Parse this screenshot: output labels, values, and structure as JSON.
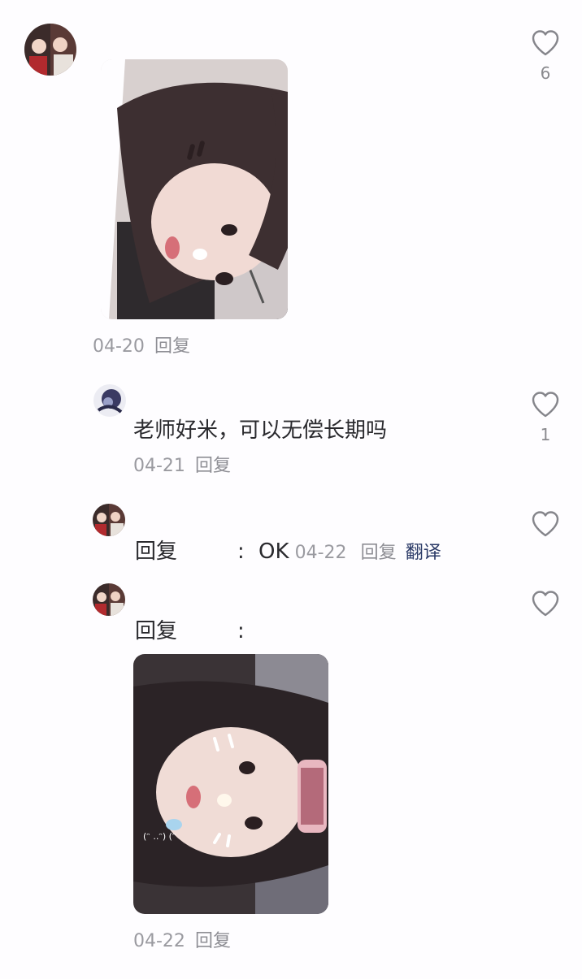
{
  "comments": [
    {
      "likes": "6",
      "date": "04-20",
      "reply_label": "回复"
    },
    {
      "text": "老师好米，可以无偿长期吗",
      "likes": "1",
      "date": "04-21",
      "reply_label": "回复"
    },
    {
      "reply_prefix": "回复",
      "colon": ":",
      "text": "OK",
      "date": "04-22",
      "reply_label": "回复",
      "translate_label": "翻译"
    },
    {
      "reply_prefix": "回复",
      "colon": ":",
      "date": "04-22",
      "reply_label": "回复"
    }
  ],
  "icons": {
    "like": "heart-outline-icon"
  },
  "colors": {
    "background": "#fefdff",
    "meta_text": "#9a9aa0",
    "body_text": "#2a2a2e",
    "translate_link": "#2b3a67"
  }
}
